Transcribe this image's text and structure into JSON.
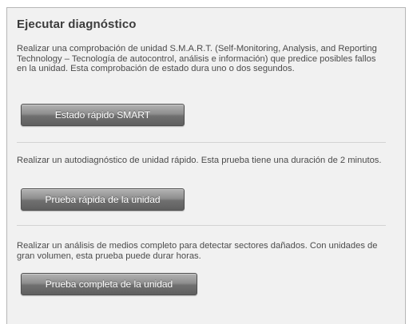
{
  "panel": {
    "title": "Ejecutar diagnóstico",
    "sections": [
      {
        "description": "Realizar una comprobación de unidad S.M.A.R.T. (Self-Monitoring, Analysis, and Reporting Technology – Tecnología de autocontrol, análisis e información) que predice posibles fallos en la unidad. Esta comprobación de estado dura uno o dos segundos.",
        "button_label": "Estado rápido SMART"
      },
      {
        "description": "Realizar un autodiagnóstico de unidad rápido. Esta prueba tiene una duración de 2 minutos.",
        "button_label": "Prueba rápida de la unidad"
      },
      {
        "description": "Realizar un análisis de medios completo para detectar sectores dañados. Con unidades de gran volumen, esta prueba puede durar horas.",
        "button_label": "Prueba completa de la unidad"
      }
    ]
  },
  "colors": {
    "panel_background": "#f1f1f1",
    "button_gradient_top": "#b3b3b3",
    "button_gradient_bottom": "#5f5f5f",
    "text": "#4b4b4b"
  }
}
